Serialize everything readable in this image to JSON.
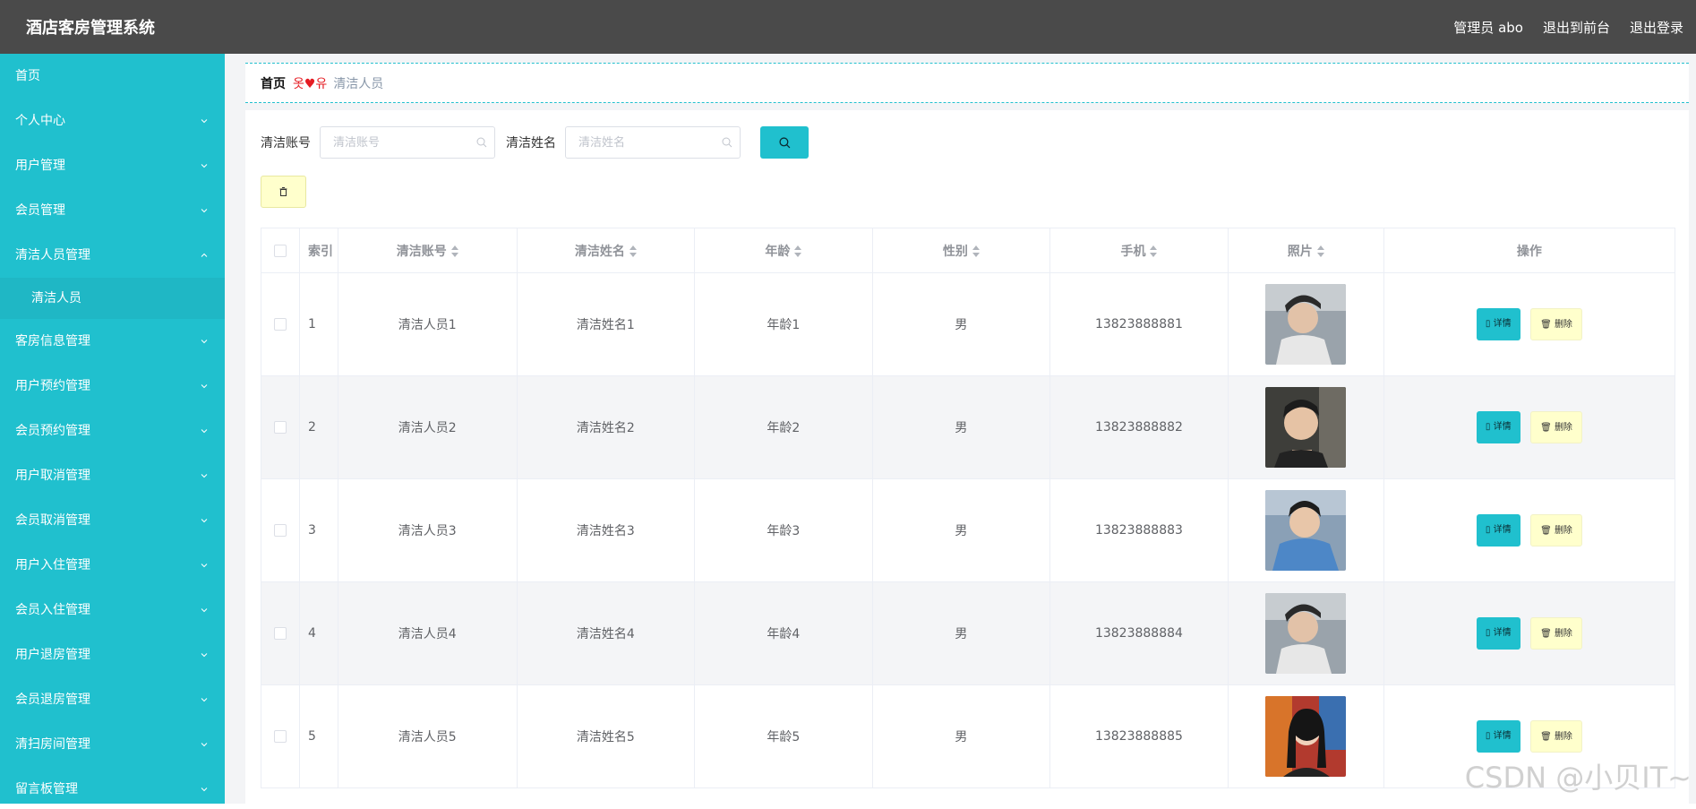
{
  "header": {
    "title": "酒店客房管理系统",
    "admin": "管理员 abo",
    "to_front": "退出到前台",
    "logout": "退出登录"
  },
  "sidebar": {
    "items": [
      {
        "label": "首页",
        "chevron": "none"
      },
      {
        "label": "个人中心",
        "chevron": "down"
      },
      {
        "label": "用户管理",
        "chevron": "down"
      },
      {
        "label": "会员管理",
        "chevron": "down"
      },
      {
        "label": "清洁人员管理",
        "chevron": "up"
      },
      {
        "label": "清洁人员",
        "sub": true
      },
      {
        "label": "客房信息管理",
        "chevron": "down"
      },
      {
        "label": "用户预约管理",
        "chevron": "down"
      },
      {
        "label": "会员预约管理",
        "chevron": "down"
      },
      {
        "label": "用户取消管理",
        "chevron": "down"
      },
      {
        "label": "会员取消管理",
        "chevron": "down"
      },
      {
        "label": "用户入住管理",
        "chevron": "down"
      },
      {
        "label": "会员入住管理",
        "chevron": "down"
      },
      {
        "label": "用户退房管理",
        "chevron": "down"
      },
      {
        "label": "会员退房管理",
        "chevron": "down"
      },
      {
        "label": "清扫房间管理",
        "chevron": "down"
      },
      {
        "label": "留言板管理",
        "chevron": "down"
      }
    ]
  },
  "breadcrumb": {
    "home": "首页",
    "separator": "옷♥유",
    "current": "清洁人员"
  },
  "search": {
    "account_label": "清洁账号",
    "account_placeholder": "清洁账号",
    "name_label": "清洁姓名",
    "name_placeholder": "清洁姓名"
  },
  "table": {
    "headers": [
      "索引",
      "清洁账号",
      "清洁姓名",
      "年龄",
      "性别",
      "手机",
      "照片",
      "操作"
    ],
    "detail_label": "详情",
    "delete_label": "删除",
    "rows": [
      {
        "index": "1",
        "account": "清洁人员1",
        "name": "清洁姓名1",
        "age": "年龄1",
        "gender": "男",
        "phone": "13823888881"
      },
      {
        "index": "2",
        "account": "清洁人员2",
        "name": "清洁姓名2",
        "age": "年龄2",
        "gender": "男",
        "phone": "13823888882"
      },
      {
        "index": "3",
        "account": "清洁人员3",
        "name": "清洁姓名3",
        "age": "年龄3",
        "gender": "男",
        "phone": "13823888883"
      },
      {
        "index": "4",
        "account": "清洁人员4",
        "name": "清洁姓名4",
        "age": "年龄4",
        "gender": "男",
        "phone": "13823888884"
      },
      {
        "index": "5",
        "account": "清洁人员5",
        "name": "清洁姓名5",
        "age": "年龄5",
        "gender": "男",
        "phone": "13823888885"
      }
    ]
  },
  "watermark": "CSDN @小贝IT~",
  "colors": {
    "header": "#4a4a4a",
    "sidebar": "#20c0ce",
    "accent": "#20c0ce",
    "delete_bg": "#ffffcc"
  }
}
